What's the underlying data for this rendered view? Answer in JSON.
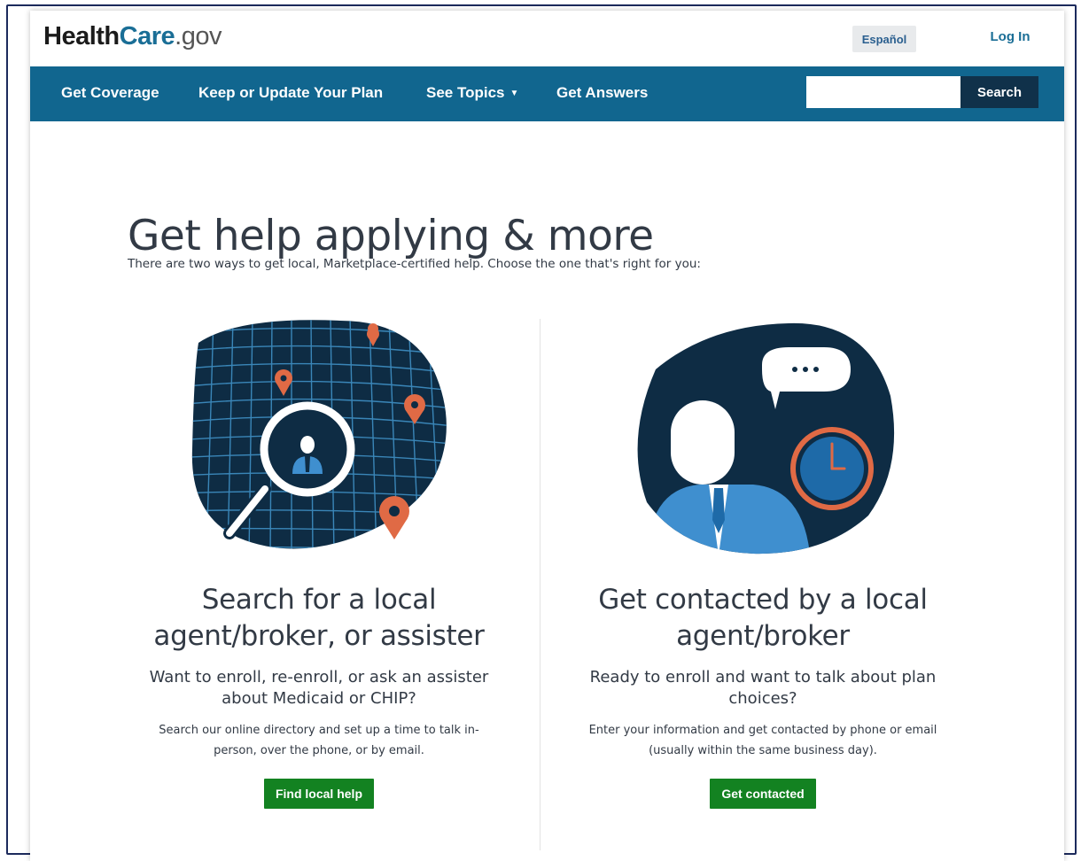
{
  "header": {
    "logo_part1": "Health",
    "logo_part2": "Care",
    "logo_part3": ".gov",
    "espanol_label": "Español",
    "login_label": "Log In"
  },
  "nav": {
    "items": [
      "Get Coverage",
      "Keep or Update Your Plan",
      "See Topics",
      "Get Answers"
    ],
    "search_value": "",
    "search_button": "Search"
  },
  "main": {
    "title": "Get help applying & more",
    "intro": "There are two ways to get local, Marketplace-certified help. Choose the one that's right for you:"
  },
  "options": [
    {
      "heading": "Search for a local\nagent/broker, or assister",
      "sub": "Want to enroll, re-enroll, or ask an assister\nabout Medicaid or CHIP?",
      "body": "Search our online directory and set up a time to talk in-\nperson, over the phone, or by email.",
      "button": "Find local help"
    },
    {
      "heading": "Get contacted by a local\nagent/broker",
      "sub": "Ready to enroll and want to talk about plan\nchoices?",
      "body": "Enter your information and get contacted by phone or email\n(usually within the same business day).",
      "button": "Get contacted"
    }
  ],
  "colors": {
    "nav_bg": "#11668f",
    "search_btn_bg": "#10314a",
    "cta_green": "#138221",
    "illustration_dark": "#0e2c44",
    "pin_orange": "#e06a45",
    "person_blue": "#3f8fcf"
  },
  "icons": {
    "search_illustration": "magnifier-map-icon",
    "contact_illustration": "person-speech-clock-icon",
    "dropdown": "caret-down-icon"
  }
}
